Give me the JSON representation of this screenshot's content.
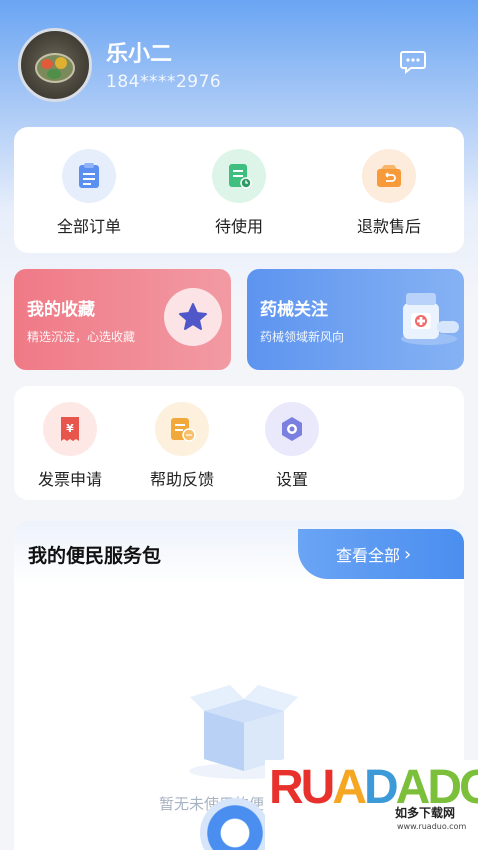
{
  "user": {
    "name": "乐小二",
    "phone": "184****2976"
  },
  "orders": {
    "items": [
      {
        "label": "全部订单",
        "icon": "order-list-icon"
      },
      {
        "label": "待使用",
        "icon": "pending-use-icon"
      },
      {
        "label": "退款售后",
        "icon": "refund-icon"
      }
    ]
  },
  "promos": {
    "favorites": {
      "title": "我的收藏",
      "subtitle": "精选沉淀，心选收藏",
      "icon": "star-icon"
    },
    "drugs": {
      "title": "药械关注",
      "subtitle": "药械领域新风向",
      "icon": "medicine-bottle-icon"
    }
  },
  "tools": {
    "items": [
      {
        "label": "发票申请",
        "icon": "invoice-icon"
      },
      {
        "label": "帮助反馈",
        "icon": "help-feedback-icon"
      },
      {
        "label": "设置",
        "icon": "settings-icon"
      }
    ]
  },
  "service": {
    "title": "我的便民服务包",
    "view_all": "查看全部",
    "empty_text": "暂无未使用的便"
  },
  "watermark": {
    "logo": "RUADADO",
    "name": "如多下载网",
    "url": "www.ruaduo.com"
  },
  "colors": {
    "accent_blue": "#4a8ef0",
    "favorites_pink": "#ef7a86",
    "order_blue": "#5b8ff0",
    "pending_green": "#3fbf7f",
    "refund_orange": "#f79a3a"
  }
}
